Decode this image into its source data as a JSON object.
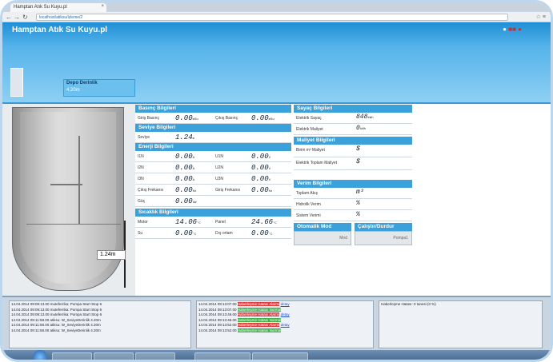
{
  "browser": {
    "tab_title": "Hamptan Atık Su Kuyu.pl",
    "url": "localhost/atiksu/izleme/2",
    "right_icons": "☆ ≡"
  },
  "header": {
    "title": "Hamptan Atık Su Kuyu.pl",
    "depot": {
      "title": "Depo Derinlik",
      "value": "4.20m"
    }
  },
  "tank": {
    "level_label": "1.24m"
  },
  "panels": {
    "basinc": {
      "title": "Basınç Bilgileri",
      "rows": [
        {
          "l1": "Giriş Basınç",
          "v1": "0.00",
          "u1": "mSu",
          "l2": "Çıkış Basınç",
          "v2": "0.00",
          "u2": "mSu"
        }
      ]
    },
    "seviye": {
      "title": "Seviye Bilgileri",
      "rows": [
        {
          "l1": "Seviye",
          "v1": "1.24",
          "u1": "m"
        }
      ]
    },
    "enerji": {
      "title": "Enerji Bilgileri",
      "rows": [
        {
          "l1": "I1N",
          "v1": "0.00",
          "u1": "A",
          "l2": "U1N",
          "v2": "0.00",
          "u2": "V"
        },
        {
          "l1": "I2N",
          "v1": "0.00",
          "u1": "A",
          "l2": "U2N",
          "v2": "0.00",
          "u2": "V"
        },
        {
          "l1": "I3N",
          "v1": "0.00",
          "u1": "A",
          "l2": "U3N",
          "v2": "0.00",
          "u2": "V"
        },
        {
          "l1": "Çıkış Frekansı",
          "v1": "0.00",
          "u1": "Hz",
          "l2": "Giriş Frekansı",
          "v2": "0.00",
          "u2": "Hz"
        },
        {
          "l1": "Güç",
          "v1": "0.00",
          "u1": "kW"
        }
      ]
    },
    "sicaklik": {
      "title": "Sıcaklık Bilgileri",
      "rows": [
        {
          "l1": "Motor",
          "v1": "14.06",
          "u1": "°C",
          "l2": "Panel",
          "v2": "24.66",
          "u2": "°C"
        },
        {
          "l1": "Su",
          "v1": "0.00",
          "u1": "°C",
          "l2": "Dış ortam",
          "v2": "0.00",
          "u2": "°C"
        }
      ]
    },
    "sayac": {
      "title": "Sayaç Bilgileri",
      "rows": [
        {
          "l": "Elektrik Sayaç",
          "v": "848",
          "u": "kWh"
        },
        {
          "l": "Elektrik Maliyet",
          "v": "0",
          "u": "kWh"
        }
      ]
    },
    "maliyet": {
      "title": "Maliyet Bilgileri",
      "rows": [
        {
          "l": "Birim m³ Maliyet",
          "v": "$"
        },
        {
          "l": "Elektrik Toplam Maliyet",
          "v": "$"
        }
      ]
    },
    "verim": {
      "title": "Verim Bilgileri",
      "rows": [
        {
          "l": "Toplam Akış",
          "v": "m³"
        },
        {
          "l": "Hidrolik Verim",
          "v": "%"
        },
        {
          "l": "Sistem Verimi",
          "v": "%"
        }
      ]
    },
    "otomatik": {
      "title": "Otomatik Mod",
      "button": "Mod"
    },
    "calisma": {
      "title": "Çalıştır/Durdur",
      "button": "Pompa1"
    }
  },
  "log": {
    "col1": [
      "14.04.2014 09:09:13.00 muteferrika: Pompa Start Stop 6",
      "14.04.2014 09:09:13.00 muteferrika: Pompa Start Stop 6",
      "14.04.2014 09:09:13.00 muteferrika: Pompa Start Stop 6",
      "14.04.2014 09:11:58.00 atiksu: W_SeviyeDerinlik 4.20m",
      "14.04.2014 09:11:58.00 atiksu: W_SeviyeDerinlik 4.20m",
      "14.04.2014 09:11:58.00 atiksu: W_SeviyeDerinlik 4.20m"
    ],
    "col2": [
      {
        "t": "14.04.2014 09:13:07.00",
        "s": "Haberleşme Hatası Alarmı",
        "k": "red",
        "link": "detay"
      },
      {
        "t": "14.04.2014 09:13:07.00",
        "s": "Haberleşme Hatası Normal",
        "k": "green",
        "link": ""
      },
      {
        "t": "14.04.2014 09:13:46.00",
        "s": "Haberleşme Hatası Alarmı",
        "k": "red",
        "link": "detay"
      },
      {
        "t": "14.04.2014 09:13:46.00",
        "s": "Haberleşme Hatası Normal",
        "k": "green",
        "link": ""
      },
      {
        "t": "14.04.2014 09:13:52.00",
        "s": "Haberleşme Hatası Alarmı",
        "k": "red",
        "link": "detay"
      },
      {
        "t": "14.04.2014 09:13:52.00",
        "s": "Haberleşme Hatası Normal",
        "k": "green",
        "link": ""
      }
    ],
    "col3": [
      "Haberleşme Hatası: 0 tanesi (0 %)"
    ]
  },
  "colors": {
    "accent": "#3aa1da",
    "header": "#55b3ea",
    "alarm": "#e03a3a",
    "ok": "#3fb04a"
  }
}
